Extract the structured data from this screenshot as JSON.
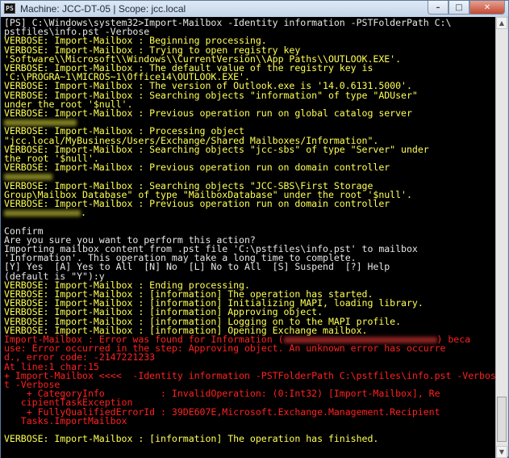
{
  "window": {
    "title": "Machine: JCC-DT-05 | Scope: jcc.local",
    "app_icon": "PS",
    "controls": {
      "minimize": "–",
      "maximize": "□",
      "close": "✕"
    }
  },
  "console": {
    "lines": [
      {
        "c": "w",
        "t": "[PS] C:\\Windows\\system32>Import-Mailbox -Identity information -PSTFolderPath C:\\"
      },
      {
        "c": "w",
        "t": "pstfiles\\info.pst -Verbose"
      },
      {
        "c": "y",
        "t": "VERBOSE: Import-Mailbox : Beginning processing."
      },
      {
        "c": "y",
        "t": "VERBOSE: Import-Mailbox : Trying to open registry key"
      },
      {
        "c": "y",
        "t": "'Software\\\\Microsoft\\\\Windows\\\\CurrentVersion\\\\App Paths\\\\OUTLOOK.EXE'."
      },
      {
        "c": "y",
        "t": "VERBOSE: Import-Mailbox : The default value of the registry key is"
      },
      {
        "c": "y",
        "t": "'C:\\PROGRA~1\\MICROS~1\\Office14\\OUTLOOK.EXE'."
      },
      {
        "c": "y",
        "t": "VERBOSE: Import-Mailbox : The version of Outlook.exe is '14.0.6131.5000'."
      },
      {
        "c": "y",
        "t": "VERBOSE: Import-Mailbox : Searching objects \"information\" of type \"ADUser\""
      },
      {
        "c": "y",
        "t": "under the root '$null'."
      },
      {
        "c": "y",
        "t": "VERBOSE: Import-Mailbox : Previous operation run on global catalog server"
      },
      {
        "c": "y",
        "t": "",
        "blur": true,
        "blur_width": 90
      },
      {
        "c": "y",
        "t": "VERBOSE: Import-Mailbox : Processing object"
      },
      {
        "c": "y",
        "t": "\"jcc.local/MyBusiness/Users/Exchange/Shared Mailboxes/Information\"."
      },
      {
        "c": "y",
        "t": "VERBOSE: Import-Mailbox : Searching objects \"jcc-sbs\" of type \"Server\" under"
      },
      {
        "c": "y",
        "t": "the root '$null'."
      },
      {
        "c": "y",
        "t": "VERBOSE: Import-Mailbox : Previous operation run on domain controller"
      },
      {
        "c": "y",
        "t": "",
        "blur": true,
        "blur_width": 60
      },
      {
        "c": "y",
        "t": "VERBOSE: Import-Mailbox : Searching objects \"JCC-SBS\\First Storage"
      },
      {
        "c": "y",
        "t": "Group\\Mailbox Database\" of type \"MailboxDatabase\" under the root '$null'."
      },
      {
        "c": "y",
        "t": "VERBOSE: Import-Mailbox : Previous operation run on domain controller"
      },
      {
        "c": "y",
        "t": ".",
        "blur": true,
        "blur_width": 95,
        "blur_before": true
      },
      {
        "c": "w",
        "t": ""
      },
      {
        "c": "w",
        "t": "Confirm"
      },
      {
        "c": "w",
        "t": "Are you sure you want to perform this action?"
      },
      {
        "c": "w",
        "t": "Importing mailbox content from .pst file 'C:\\pstfiles\\info.pst' to mailbox"
      },
      {
        "c": "w",
        "t": "'Information'. This operation may take a long time to complete."
      },
      {
        "c": "w",
        "t": "[Y] Yes  [A] Yes to All  [N] No  [L] No to All  [S] Suspend  [?] Help"
      },
      {
        "c": "w",
        "t": "(default is \"Y\"):y"
      },
      {
        "c": "y",
        "t": "VERBOSE: Import-Mailbox : Ending processing."
      },
      {
        "c": "y",
        "t": "VERBOSE: Import-Mailbox : [information] The operation has started."
      },
      {
        "c": "y",
        "t": "VERBOSE: Import-Mailbox : [information] Initializing MAPI, loading library."
      },
      {
        "c": "y",
        "t": "VERBOSE: Import-Mailbox : [information] Approving object."
      },
      {
        "c": "y",
        "t": "VERBOSE: Import-Mailbox : [information] Logging on to the MAPI profile."
      },
      {
        "c": "y",
        "t": "VERBOSE: Import-Mailbox : [information] Opening Exchange mailbox."
      },
      {
        "c": "r",
        "t": "Import-Mailbox : Error was found for Information (",
        "blur": true,
        "blur_width": 190,
        "tail": ") beca"
      },
      {
        "c": "r",
        "t": "use: Error occurred in the step: Approving object. An unknown error has occurre"
      },
      {
        "c": "r",
        "t": "d., error code: -2147221233"
      },
      {
        "c": "r",
        "t": "At line:1 char:15"
      },
      {
        "c": "r",
        "t": "+ Import-Mailbox <<<<  -Identity information -PSTFolderPath C:\\pstfiles\\info.pst -Verbose"
      },
      {
        "c": "r",
        "t": "t -Verbose"
      },
      {
        "c": "r",
        "t": "    + CategoryInfo          : InvalidOperation: (0:Int32) [Import-Mailbox], Re"
      },
      {
        "c": "r",
        "t": "   cipientTaskException"
      },
      {
        "c": "r",
        "t": "    + FullyQualifiedErrorId : 39DE607E,Microsoft.Exchange.Management.Recipient"
      },
      {
        "c": "r",
        "t": "   Tasks.ImportMailbox"
      },
      {
        "c": "w",
        "t": ""
      },
      {
        "c": "y",
        "t": "VERBOSE: Import-Mailbox : [information] The operation has finished."
      }
    ]
  },
  "scrollbar": {
    "up_arrow": "▲",
    "down_arrow": "▼"
  }
}
